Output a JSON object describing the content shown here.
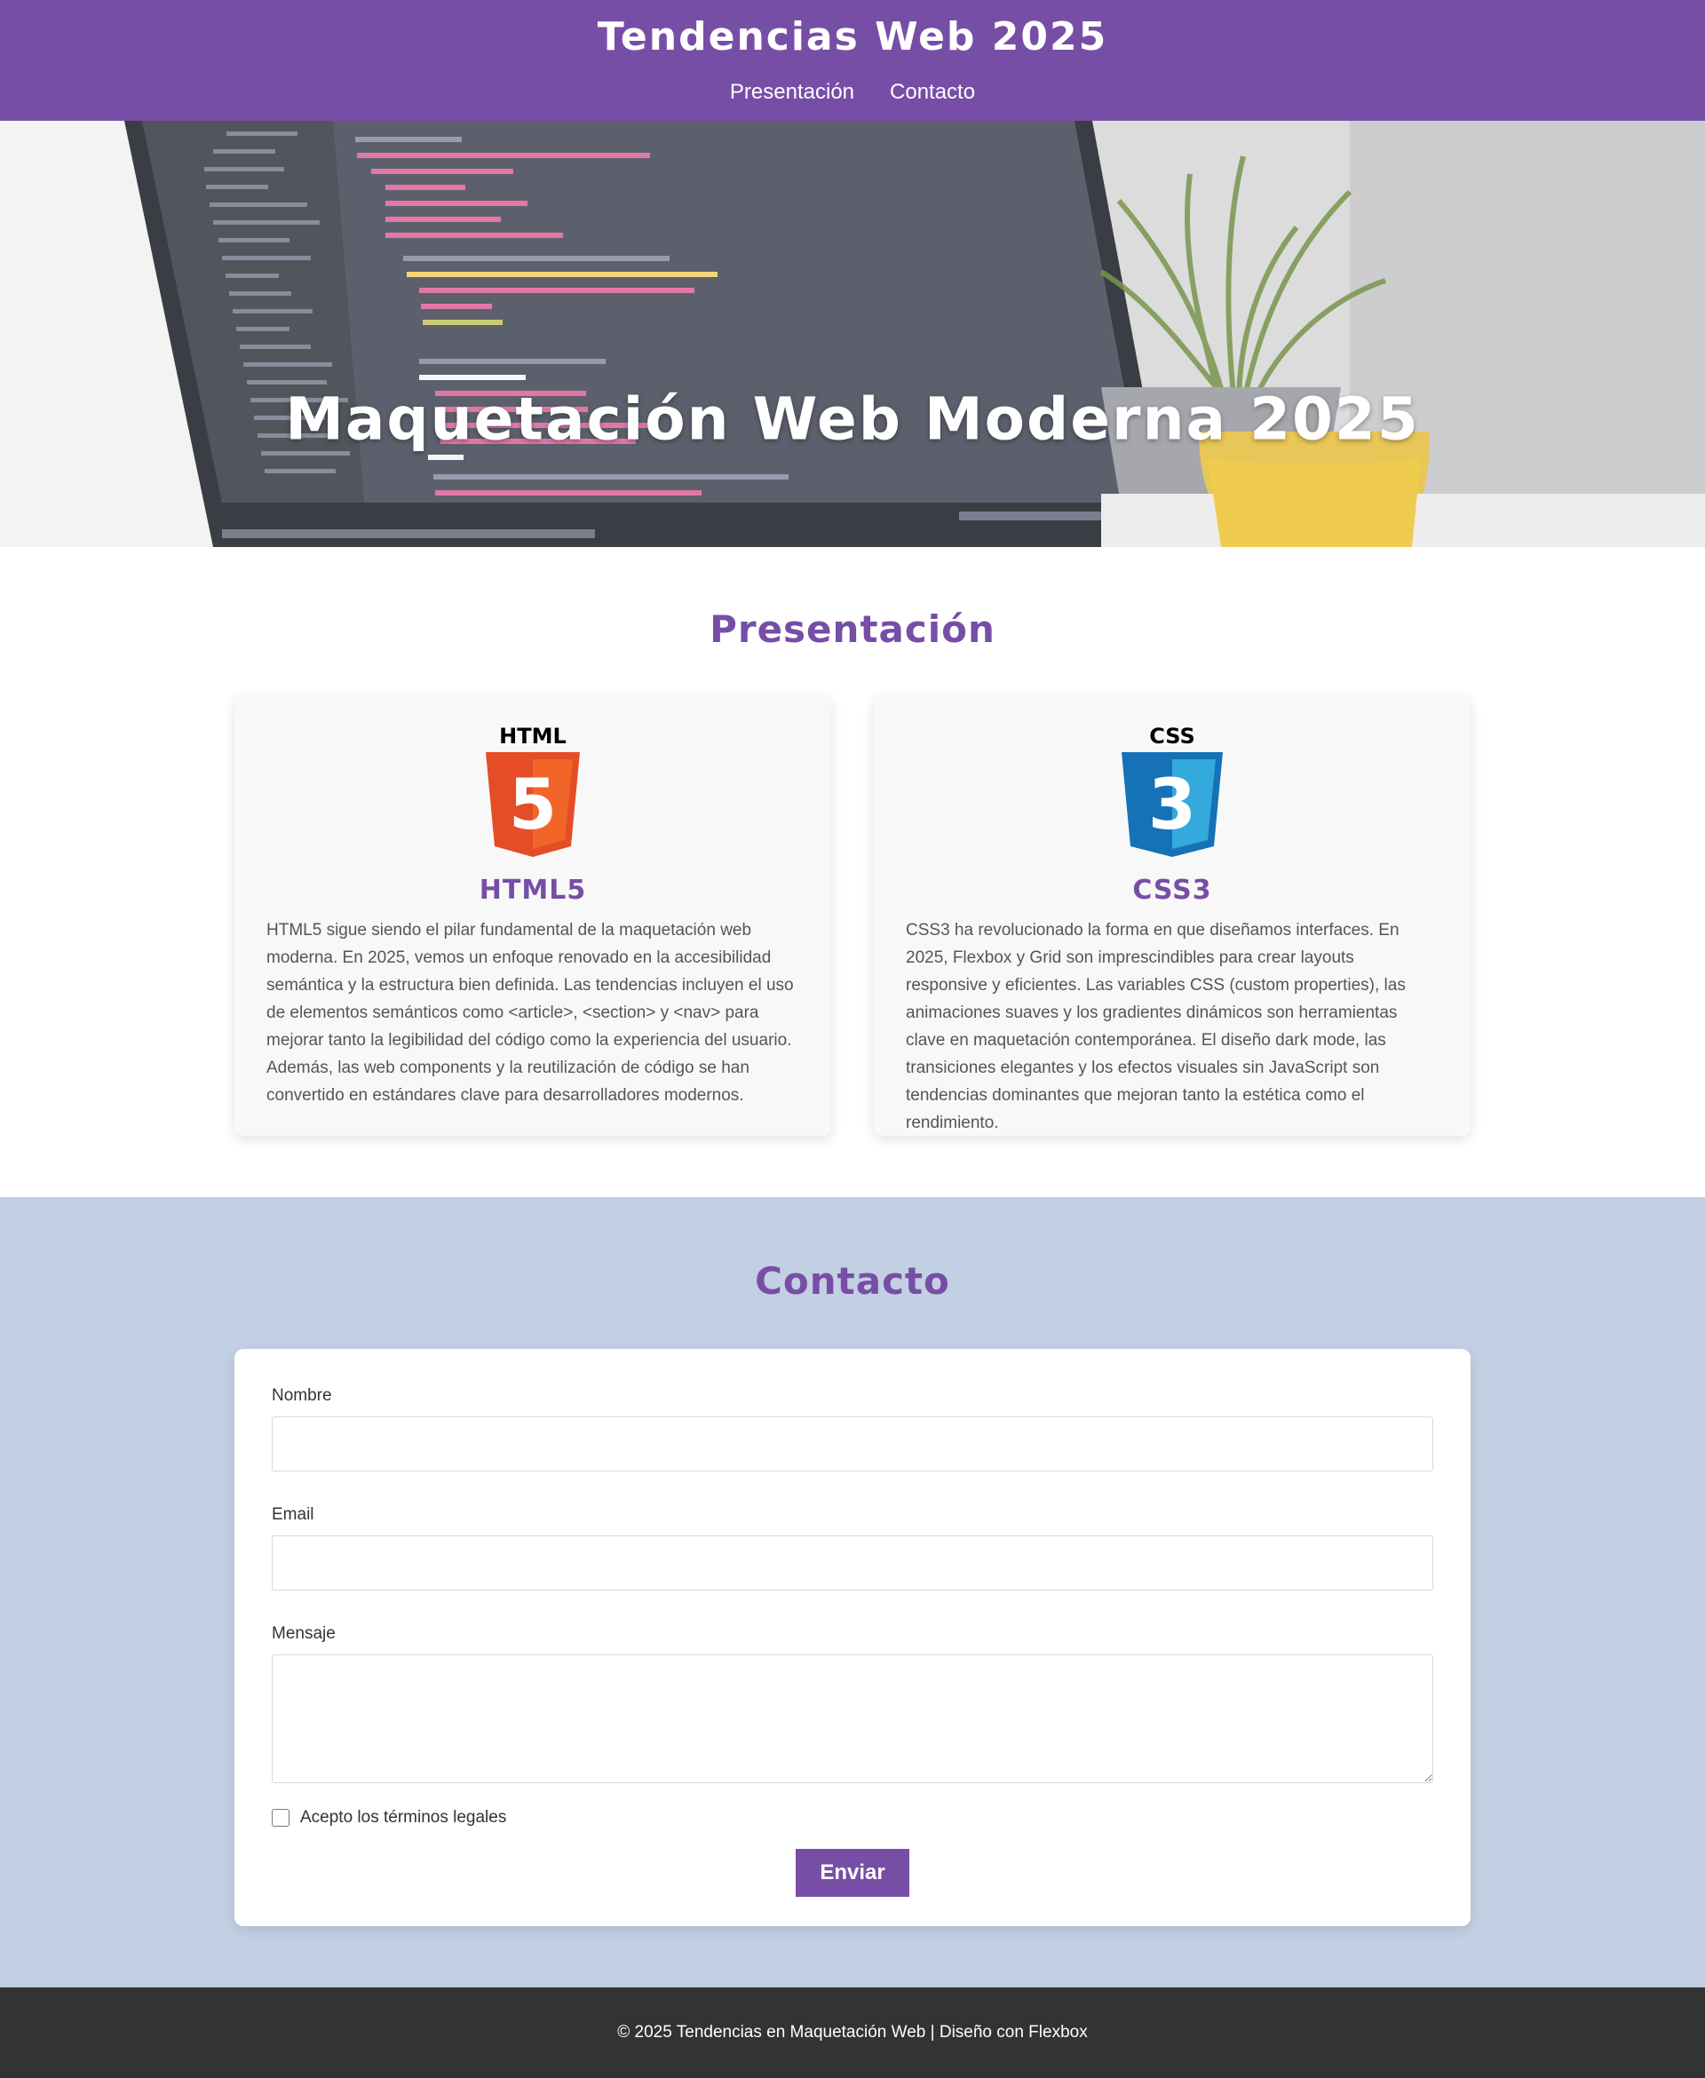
{
  "header": {
    "title": "Tendencias Web 2025",
    "nav": [
      {
        "label": "Presentación"
      },
      {
        "label": "Contacto"
      }
    ]
  },
  "hero": {
    "title": "Maquetación Web Moderna 2025"
  },
  "presentacion": {
    "title": "Presentación",
    "cards": [
      {
        "logo_text": "HTML",
        "logo_number": "5",
        "title": "HTML5",
        "text": "HTML5 sigue siendo el pilar fundamental de la maquetación web moderna. En 2025, vemos un enfoque renovado en la accesibilidad semántica y la estructura bien definida. Las tendencias incluyen el uso de elementos semánticos como <article>, <section> y <nav> para mejorar tanto la legibilidad del código como la experiencia del usuario. Además, las web components y la reutilización de código se han convertido en estándares clave para desarrolladores modernos.",
        "accent": "#e44d26"
      },
      {
        "logo_text": "CSS",
        "logo_number": "3",
        "title": "CSS3",
        "text": "CSS3 ha revolucionado la forma en que diseñamos interfaces. En 2025, Flexbox y Grid son imprescindibles para crear layouts responsive y eficientes. Las variables CSS (custom properties), las animaciones suaves y los gradientes dinámicos son herramientas clave en maquetación contemporánea. El diseño dark mode, las transiciones elegantes y los efectos visuales sin JavaScript son tendencias dominantes que mejoran tanto la estética como el rendimiento.",
        "accent": "#1572b6"
      }
    ]
  },
  "contacto": {
    "title": "Contacto",
    "form": {
      "name_label": "Nombre",
      "name_value": "",
      "email_label": "Email",
      "email_value": "",
      "message_label": "Mensaje",
      "message_value": "",
      "terms_label": "Acepto los términos legales",
      "terms_checked": false,
      "submit_label": "Enviar"
    }
  },
  "footer": {
    "text": "© 2025 Tendencias en Maquetación Web | Diseño con Flexbox"
  },
  "colors": {
    "brand": "#774ea6",
    "contact_bg": "#c3cfe2",
    "footer_bg": "#333333"
  }
}
